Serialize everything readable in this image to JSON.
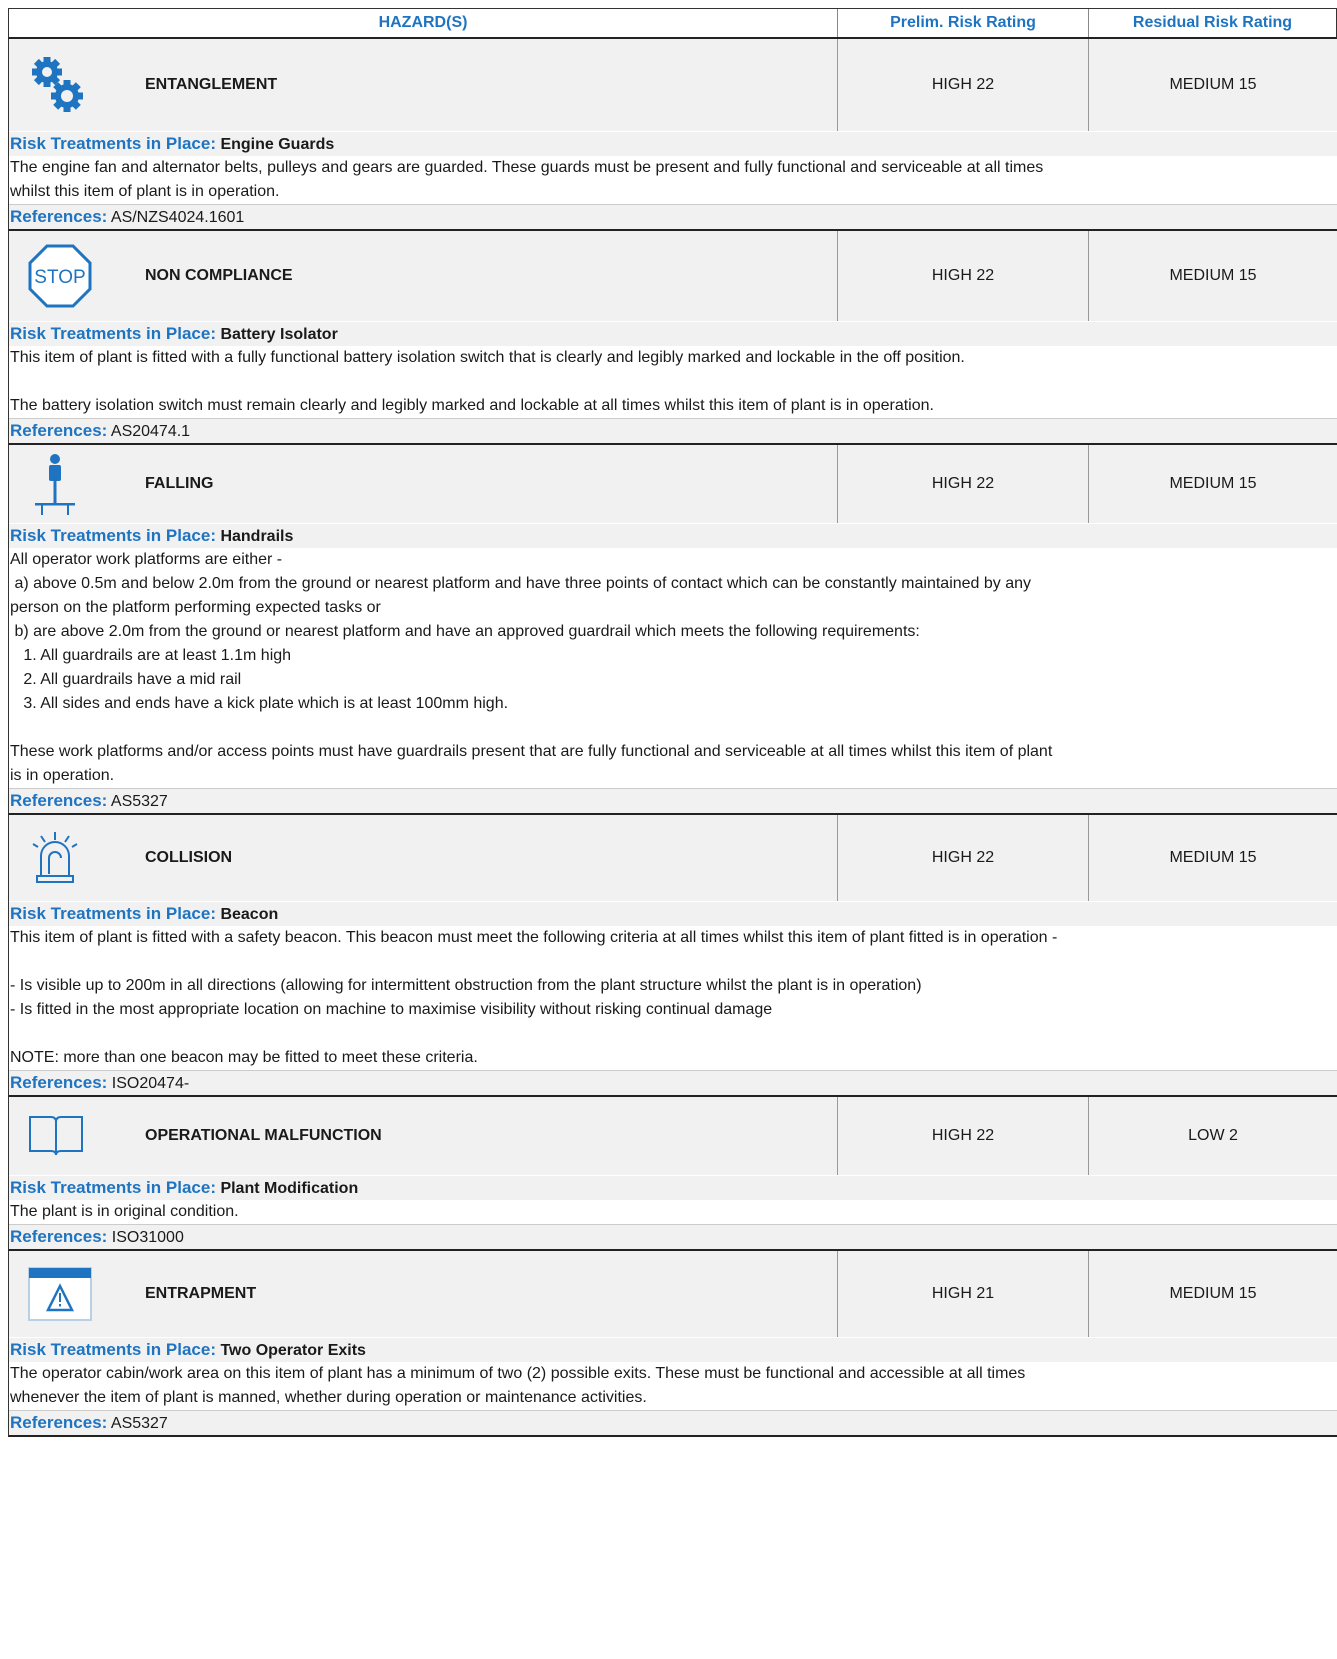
{
  "header": {
    "hazards": "HAZARD(S)",
    "prelim": "Prelim. Risk Rating",
    "residual": "Residual Risk Rating"
  },
  "labels": {
    "treatments": "Risk Treatments in Place:",
    "references": "References:"
  },
  "hazards": [
    {
      "icon": "gears-icon",
      "name": "ENTANGLEMENT",
      "prelim": "HIGH 22",
      "residual": "MEDIUM 15",
      "treatment": "Engine Guards",
      "lines": [
        "The engine fan and alternator belts, pulleys and gears are guarded. These guards must be present and fully functional and serviceable at all times",
        "whilst this item of plant is in operation."
      ],
      "reference": "AS/NZS4024.1601"
    },
    {
      "icon": "stop-sign-icon",
      "name": "NON COMPLIANCE",
      "prelim": "HIGH 22",
      "residual": "MEDIUM 15",
      "treatment": "Battery Isolator",
      "lines": [
        "This item of plant is fitted with a fully functional battery isolation switch that is clearly and legibly marked and lockable in the off position.",
        "",
        "The battery isolation switch must remain clearly and legibly marked and lockable at all times whilst this item of plant is in operation."
      ],
      "reference": "AS20474.1"
    },
    {
      "icon": "falling-person-icon",
      "name": "FALLING",
      "prelim": "HIGH 22",
      "residual": "MEDIUM 15",
      "treatment": "Handrails",
      "lines": [
        "All operator work platforms are either -",
        " a) above 0.5m and below 2.0m from the ground or nearest platform and have three points of contact which can be constantly maintained by any",
        "person on the platform performing expected tasks or",
        " b) are above 2.0m from the ground or nearest platform and have an approved guardrail which meets the following requirements:",
        "   1. All guardrails are at least 1.1m high",
        "   2. All guardrails have a mid rail",
        "   3. All sides and ends have a kick plate which is at least 100mm high.",
        "",
        "These work platforms and/or access points must have guardrails present that are fully functional and serviceable at all times whilst this item of plant",
        "is in operation."
      ],
      "reference": "AS5327"
    },
    {
      "icon": "beacon-icon",
      "name": "COLLISION",
      "prelim": "HIGH 22",
      "residual": "MEDIUM 15",
      "treatment": "Beacon",
      "lines": [
        "This item of plant is fitted with a safety beacon. This beacon must meet the following criteria at all times whilst this item of plant fitted is in operation -",
        "",
        "- Is visible up to 200m in all directions (allowing for intermittent obstruction from the plant structure whilst the plant is in operation)",
        "- Is fitted in the most appropriate location on machine to maximise visibility without risking continual damage",
        "",
        "NOTE: more than one beacon may be fitted to meet these criteria."
      ],
      "reference": "ISO20474-"
    },
    {
      "icon": "manual-book-icon",
      "name": "OPERATIONAL MALFUNCTION",
      "prelim": "HIGH 22",
      "residual": "LOW 2",
      "treatment": "Plant Modification",
      "lines": [
        "The plant is in original condition."
      ],
      "reference": "ISO31000"
    },
    {
      "icon": "warning-window-icon",
      "name": "ENTRAPMENT",
      "prelim": "HIGH 21",
      "residual": "MEDIUM 15",
      "treatment": "Two Operator Exits",
      "lines": [
        "The operator cabin/work area on this item of plant has a minimum of two (2) possible exits. These must be functional and accessible at all times",
        "whenever the item of plant is manned, whether during operation or maintenance activities."
      ],
      "reference": "AS5327"
    }
  ]
}
